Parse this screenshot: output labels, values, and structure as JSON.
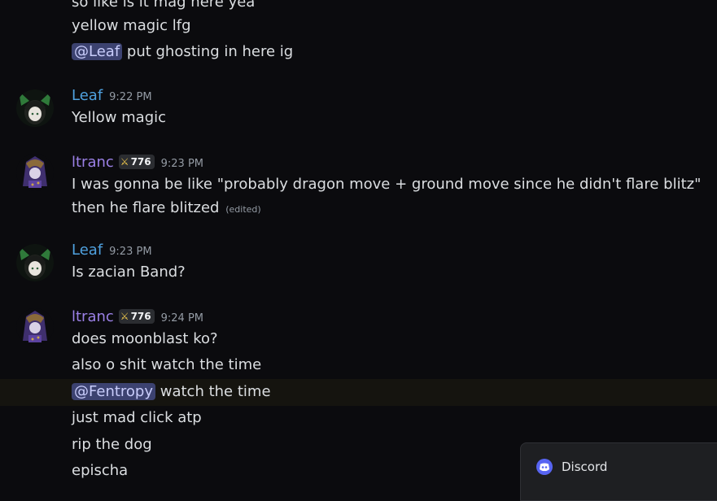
{
  "messages": {
    "top_cut": "so like is it mag here yea",
    "m1": "yellow magic lfg",
    "m2_mention": "@Leaf",
    "m2_text": "put ghosting in here ig",
    "leaf1": {
      "username": "Leaf",
      "time": "9:22 PM",
      "text": "Yellow magic"
    },
    "ltranc1": {
      "username": "ltranc",
      "badge": "776",
      "time": "9:23 PM",
      "text": "I was gonna be like \"probably dragon move + ground move since he didn't flare blitz\" then he flare blitzed",
      "edited": "(edited)"
    },
    "leaf2": {
      "username": "Leaf",
      "time": "9:23 PM",
      "text": "Is zacian Band?"
    },
    "ltranc2": {
      "username": "ltranc",
      "badge": "776",
      "time": "9:24 PM",
      "text": "does moonblast ko?"
    },
    "l2": "also o shit watch the time",
    "l3_mention": "@Fentropy",
    "l3_text": "watch the time",
    "l4": "just mad click atp",
    "l5": "rip the dog",
    "l6": "epischa"
  },
  "toast": {
    "label": "Discord"
  },
  "colors": {
    "leaf": "#4fa1df",
    "ltranc": "#9b80e6",
    "mention_bg": "#3c4270",
    "discord_blurple": "#5865f2"
  },
  "icons": {
    "badge_icon": "sword-icon",
    "toast_icon": "discord-logo-icon"
  }
}
